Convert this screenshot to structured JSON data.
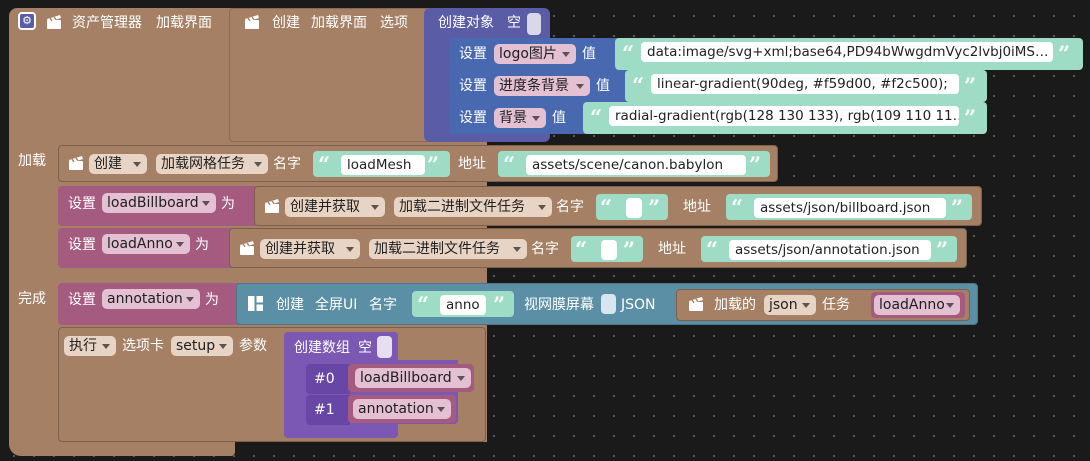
{
  "colors": {
    "brown": "#a58065",
    "teal": "#5b8fa6",
    "purple": "#5b5ca6",
    "setblue": "#4869b0",
    "magenta": "#a55b80",
    "mint": "#9fdcc6",
    "violet": "#7a58b4"
  },
  "root": {
    "label": "资产管理器",
    "sub": "加载界面",
    "load_label": "加载",
    "done_label": "完成"
  },
  "create_ui": {
    "create": "创建",
    "what": "加载界面",
    "options": "选项"
  },
  "obj": {
    "label": "创建对象",
    "empty": "空"
  },
  "set_rows": [
    {
      "set": "设置",
      "key": "logo图片",
      "value_label": "值",
      "text": "data:image/svg+xml;base64,PD94bWwgdmVyc2lvbj0iMS…"
    },
    {
      "set": "设置",
      "key": "进度条背景",
      "value_label": "值",
      "text": "linear-gradient(90deg, #f59d00, #f2c500);"
    },
    {
      "set": "设置",
      "key": "背景",
      "value_label": "值",
      "text": "radial-gradient(rgb(128 130 133), rgb(109 110 11…"
    }
  ],
  "mesh": {
    "create": "创建",
    "task": "加载网格任务",
    "name_label": "名字",
    "name": "loadMesh",
    "addr_label": "地址",
    "addr": "assets/scene/canon.babylon"
  },
  "billboard": {
    "set": "设置",
    "var": "loadBillboard",
    "as": "为",
    "create": "创建并获取",
    "task": "加载二进制文件任务",
    "name_label": "名字",
    "addr_label": "地址",
    "addr": "assets/json/billboard.json"
  },
  "anno": {
    "set": "设置",
    "var": "loadAnno",
    "as": "为",
    "create": "创建并获取",
    "task": "加载二进制文件任务",
    "name_label": "名字",
    "addr_label": "地址",
    "addr": "assets/json/annotation.json"
  },
  "annotation": {
    "set": "设置",
    "var": "annotation",
    "as": "为",
    "create": "创建",
    "fullscreen": "全屏UI",
    "name_label": "名字",
    "name": "anno",
    "retina": "视网膜屏幕",
    "json": "JSON",
    "loaded": "加载的",
    "json_dd": "json",
    "task_label": "任务",
    "task_var": "loadAnno"
  },
  "exec": {
    "exec": "执行",
    "tab_label": "选项卡",
    "tab": "setup",
    "params": "参数"
  },
  "array": {
    "label": "创建数组",
    "empty": "空",
    "items": [
      {
        "idx": "#0",
        "var": "loadBillboard"
      },
      {
        "idx": "#1",
        "var": "annotation"
      }
    ]
  }
}
